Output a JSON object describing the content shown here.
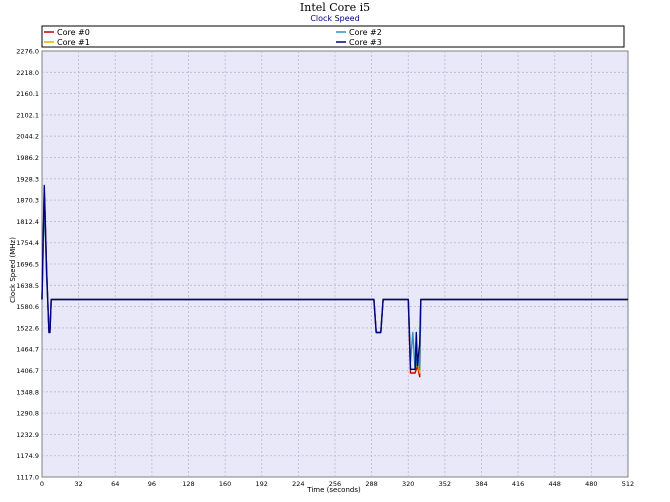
{
  "chart_data": {
    "type": "line",
    "title": "Intel Core i5",
    "subtitle": "Clock Speed",
    "xlabel": "Time (seconds)",
    "ylabel": "Clock Speed (MHz)",
    "xlim": [
      0,
      512
    ],
    "ylim": [
      1117.0,
      2276.0
    ],
    "xticks": [
      "0",
      "32",
      "64",
      "96",
      "128",
      "160",
      "192",
      "224",
      "256",
      "288",
      "320",
      "352",
      "384",
      "416",
      "448",
      "480",
      "512"
    ],
    "yticks": [
      "1117.0",
      "1174.9",
      "1232.9",
      "1290.8",
      "1348.8",
      "1406.7",
      "1464.7",
      "1522.6",
      "1580.6",
      "1638.5",
      "1696.5",
      "1754.4",
      "1812.4",
      "1870.3",
      "1928.3",
      "1986.2",
      "2044.2",
      "2102.1",
      "2160.1",
      "2218.0",
      "2276.0"
    ],
    "grid": true,
    "legend_position": "top",
    "series": [
      {
        "name": "Core #0",
        "color": "#c00000",
        "points": [
          [
            0,
            1600
          ],
          [
            1,
            1750
          ],
          [
            2,
            1890
          ],
          [
            3,
            1800
          ],
          [
            4,
            1680
          ],
          [
            5,
            1600
          ],
          [
            6,
            1520
          ],
          [
            7,
            1520
          ],
          [
            8,
            1600
          ],
          [
            290,
            1600
          ],
          [
            292,
            1510
          ],
          [
            296,
            1510
          ],
          [
            298,
            1600
          ],
          [
            320,
            1600
          ],
          [
            322,
            1400
          ],
          [
            326,
            1400
          ],
          [
            328,
            1420
          ],
          [
            330,
            1390
          ],
          [
            331,
            1600
          ],
          [
            512,
            1600
          ]
        ]
      },
      {
        "name": "Core #1",
        "color": "#e0b000",
        "points": [
          [
            0,
            1600
          ],
          [
            1,
            1740
          ],
          [
            2,
            1880
          ],
          [
            3,
            1790
          ],
          [
            4,
            1670
          ],
          [
            5,
            1600
          ],
          [
            6,
            1520
          ],
          [
            7,
            1520
          ],
          [
            8,
            1600
          ],
          [
            290,
            1600
          ],
          [
            292,
            1510
          ],
          [
            296,
            1510
          ],
          [
            298,
            1600
          ],
          [
            320,
            1600
          ],
          [
            322,
            1410
          ],
          [
            326,
            1410
          ],
          [
            328,
            1430
          ],
          [
            330,
            1400
          ],
          [
            331,
            1600
          ],
          [
            512,
            1600
          ]
        ]
      },
      {
        "name": "Core #2",
        "color": "#3090c0",
        "points": [
          [
            0,
            1600
          ],
          [
            1,
            1730
          ],
          [
            2,
            1870
          ],
          [
            3,
            1780
          ],
          [
            4,
            1660
          ],
          [
            5,
            1600
          ],
          [
            6,
            1520
          ],
          [
            7,
            1520
          ],
          [
            8,
            1600
          ],
          [
            290,
            1600
          ],
          [
            292,
            1510
          ],
          [
            296,
            1510
          ],
          [
            298,
            1600
          ],
          [
            320,
            1600
          ],
          [
            322,
            1430
          ],
          [
            324,
            1510
          ],
          [
            326,
            1410
          ],
          [
            328,
            1450
          ],
          [
            330,
            1410
          ],
          [
            331,
            1600
          ],
          [
            512,
            1600
          ]
        ]
      },
      {
        "name": "Core #3",
        "color": "#000080",
        "points": [
          [
            0,
            1600
          ],
          [
            1,
            1760
          ],
          [
            2,
            1910
          ],
          [
            3,
            1800
          ],
          [
            4,
            1680
          ],
          [
            5,
            1600
          ],
          [
            6,
            1510
          ],
          [
            7,
            1510
          ],
          [
            8,
            1600
          ],
          [
            290,
            1600
          ],
          [
            292,
            1510
          ],
          [
            296,
            1510
          ],
          [
            298,
            1600
          ],
          [
            320,
            1600
          ],
          [
            322,
            1410
          ],
          [
            326,
            1410
          ],
          [
            327,
            1510
          ],
          [
            328,
            1420
          ],
          [
            330,
            1480
          ],
          [
            331,
            1600
          ],
          [
            512,
            1600
          ]
        ]
      }
    ]
  }
}
